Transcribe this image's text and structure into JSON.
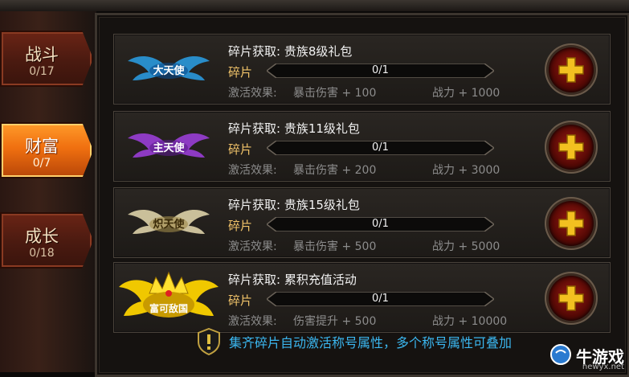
{
  "tabs": [
    {
      "label": "战斗",
      "count": "0/17",
      "active": false
    },
    {
      "label": "财富",
      "count": "0/7",
      "active": true
    },
    {
      "label": "成长",
      "count": "0/18",
      "active": false
    }
  ],
  "rows": [
    {
      "badge": "大天使",
      "title": "碎片获取: 贵族8级礼包",
      "fragment_label": "碎片",
      "progress": "0/1",
      "progress_fraction": 0,
      "effect_label": "激活效果:",
      "effect": "暴击伤害 + 100",
      "power": "战力 + 1000",
      "badge_color": "#6fd3ff"
    },
    {
      "badge": "主天使",
      "title": "碎片获取: 贵族11级礼包",
      "fragment_label": "碎片",
      "progress": "0/1",
      "progress_fraction": 0,
      "effect_label": "激活效果:",
      "effect": "暴击伤害 + 200",
      "power": "战力 + 3000",
      "badge_color": "#d36bff"
    },
    {
      "badge": "炽天使",
      "title": "碎片获取: 贵族15级礼包",
      "fragment_label": "碎片",
      "progress": "0/1",
      "progress_fraction": 0,
      "effect_label": "激活效果:",
      "effect": "暴击伤害 + 500",
      "power": "战力 + 5000",
      "badge_color": "#f3e6b8"
    },
    {
      "badge": "富可敌国",
      "title": "碎片获取: 累积充值活动",
      "fragment_label": "碎片",
      "progress": "0/1",
      "progress_fraction": 0,
      "effect_label": "激活效果:",
      "effect": "伤害提升 + 500",
      "power": "战力 + 10000",
      "badge_color": "#ffd400"
    }
  ],
  "footer": {
    "text": "集齐碎片自动激活称号属性，多个称号属性可叠加"
  },
  "watermark": {
    "main": "牛游戏",
    "sub": "newyx.net"
  },
  "colors": {
    "accent_tab": "#f07010",
    "info_text": "#3bb7f0",
    "fragment_label": "#f2c46a"
  }
}
